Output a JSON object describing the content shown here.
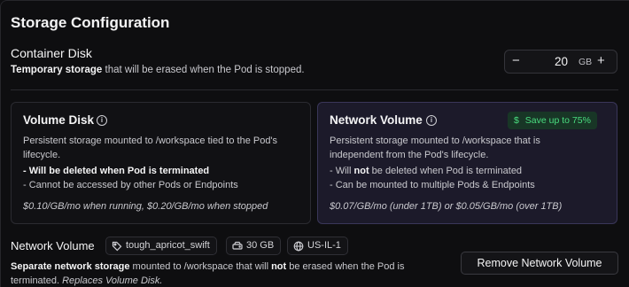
{
  "section": {
    "title": "Storage Configuration"
  },
  "container_disk": {
    "title": "Container Disk",
    "desc_bold": "Temporary storage",
    "desc_rest": " that will be erased when the Pod is stopped.",
    "value": "20",
    "unit": "GB",
    "minus": "−",
    "plus": "+"
  },
  "volume_disk": {
    "title": "Volume Disk",
    "info": "i",
    "line1": "Persistent storage mounted to /workspace tied to the Pod's",
    "line2": "lifecycle.",
    "bullet1": "- Will be deleted when Pod is terminated",
    "bullet2": "- Cannot be accessed by other Pods or Endpoints",
    "price": "$0.10/GB/mo when running, $0.20/GB/mo when stopped"
  },
  "network_volume_card": {
    "title": "Network Volume",
    "info": "i",
    "badge": "Save up to 75%",
    "line1": "Persistent storage mounted to /workspace that is",
    "line2": "independent from the Pod's lifecycle.",
    "bullet1_pre": "- Will ",
    "bullet1_bold": "not",
    "bullet1_post": " be deleted when Pod is terminated",
    "bullet2": "- Can be mounted to multiple Pods & Endpoints",
    "price": "$0.07/GB/mo (under 1TB) or $0.05/GB/mo (over 1TB)"
  },
  "network_volume": {
    "label": "Network Volume",
    "name": "tough_apricot_swift",
    "size": "30 GB",
    "region": "US-IL-1",
    "desc_bold1": "Separate network storage",
    "desc_mid": " mounted to /workspace that will ",
    "desc_bold2": "not",
    "desc_post": " be erased when the Pod is terminated. ",
    "desc_italic": "Replaces Volume Disk.",
    "remove_label": "Remove Network Volume"
  },
  "colors": {
    "accent_green": "#4ade80",
    "selected_card_bg": "#1c1a2a"
  },
  "icons": [
    "info-icon",
    "dollar-icon",
    "tag-icon",
    "drive-icon",
    "globe-icon"
  ]
}
